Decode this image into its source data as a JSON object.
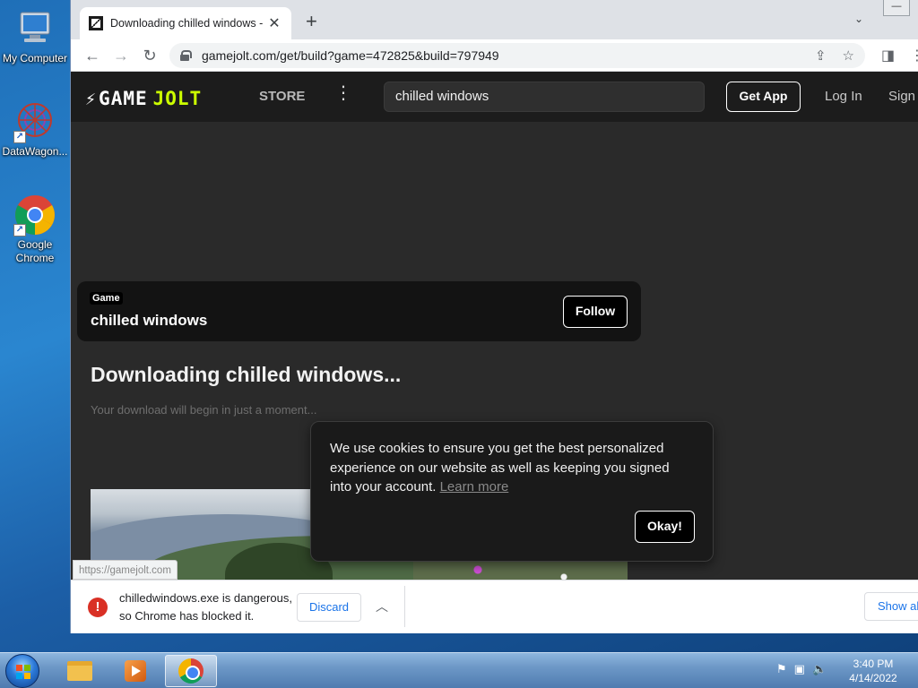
{
  "desktop": {
    "icons": [
      {
        "label": "My Computer"
      },
      {
        "label": "DataWagon..."
      },
      {
        "label": "Google Chrome"
      }
    ]
  },
  "browser": {
    "tab": {
      "title": "Downloading chilled windows - Game Jolt"
    },
    "window_buttons": {
      "minimize": "—"
    },
    "toolbar": {
      "url": "gamejolt.com/get/build?game=472825&build=797949"
    }
  },
  "gamejolt": {
    "logo_game": "GAME",
    "logo_jolt": "JOLT",
    "nav": {
      "store": "STORE"
    },
    "search": {
      "value": "chilled windows"
    },
    "get_app": "Get App",
    "login": "Log In",
    "signup": "Sign Up",
    "game_card": {
      "tag": "Game",
      "name": "chilled windows",
      "follow": "Follow"
    },
    "download": {
      "title": "Downloading chilled windows...",
      "subtitle": "Your download will begin in just a moment..."
    },
    "cookie": {
      "text": "We use cookies to ensure you get the best personalized experience on our website as well as keeping you signed into your account.",
      "learn_more": "Learn more",
      "okay": "Okay!"
    },
    "status_url": "https://gamejolt.com"
  },
  "download_bar": {
    "line1": "chilledwindows.exe is dangerous,",
    "line2": "so Chrome has blocked it.",
    "discard": "Discard",
    "show_all": "Show all"
  },
  "taskbar": {
    "clock_time": "3:40 PM",
    "clock_date": "4/14/2022"
  },
  "colors": {
    "jolt_accent": "#ccff00",
    "error_red": "#d93025",
    "link_blue": "#1a73e8"
  }
}
